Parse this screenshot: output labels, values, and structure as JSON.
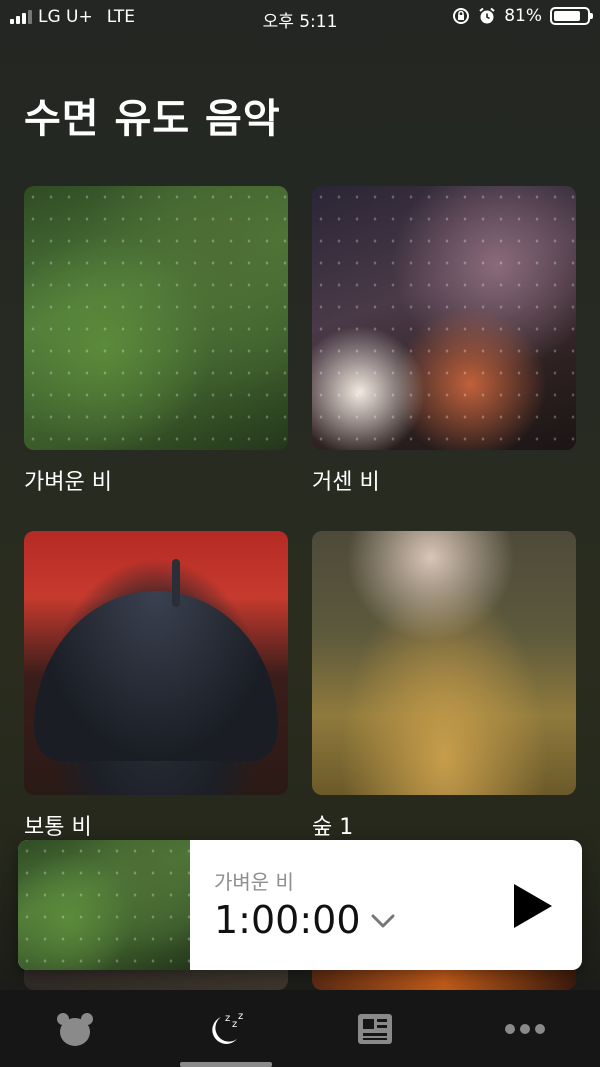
{
  "status_bar": {
    "carrier": "LG U+",
    "network": "LTE",
    "time": "오후 5:11",
    "battery": "81%",
    "battery_level": 0.81
  },
  "page": {
    "title": "수면 유도 음악"
  },
  "cards": [
    {
      "label": "가벼운 비",
      "image": "light-rain-branches"
    },
    {
      "label": "거센 비",
      "image": "heavy-rain-city-night"
    },
    {
      "label": "보통 비",
      "image": "umbrella-red-bus"
    },
    {
      "label": "숲 1",
      "image": "forest-grass-sunlight"
    }
  ],
  "mini_player": {
    "title": "가벼운 비",
    "timer": "1:00:00",
    "icons": {
      "expand": "chevron-down-icon",
      "play": "play-icon"
    }
  },
  "tab_bar": {
    "tabs": [
      {
        "id": "bear",
        "icon": "bear-icon"
      },
      {
        "id": "sleep",
        "icon": "moon-zzz-icon",
        "active": true
      },
      {
        "id": "news",
        "icon": "newspaper-icon"
      },
      {
        "id": "more",
        "icon": "more-dots-icon"
      }
    ]
  },
  "colors": {
    "background": "#25281b",
    "tab_bar": "#161616",
    "player_bg": "#ffffff",
    "active_indicator": "#8a8a8a"
  }
}
